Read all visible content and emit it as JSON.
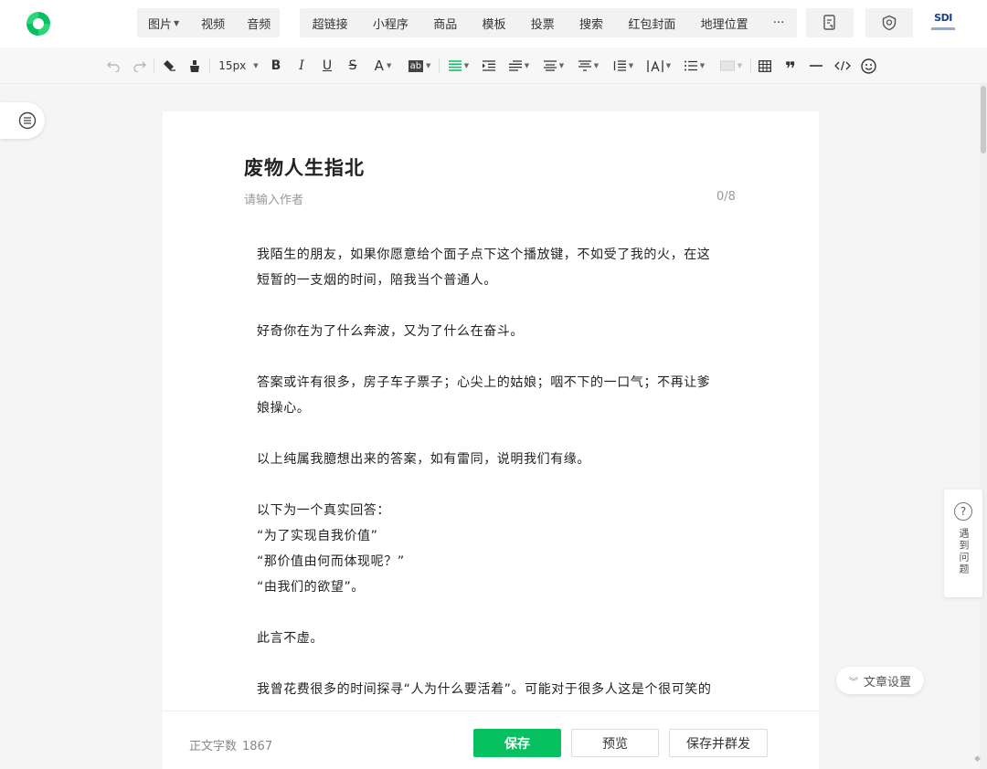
{
  "topbar": {
    "media_group": [
      {
        "label": "图片",
        "has_caret": true
      },
      {
        "label": "视频"
      },
      {
        "label": "音频"
      }
    ],
    "insert_group": [
      {
        "label": "超链接"
      },
      {
        "label": "小程序"
      },
      {
        "label": "商品"
      },
      {
        "label": "模板"
      },
      {
        "label": "投票"
      },
      {
        "label": "搜索"
      },
      {
        "label": "红包封面"
      },
      {
        "label": "地理位置"
      },
      {
        "label": "···"
      }
    ],
    "brand": {
      "logo_text": "SDI",
      "accent": "#07c160"
    }
  },
  "format_toolbar": {
    "font_size": "15px",
    "icons": [
      "undo-icon",
      "redo-icon",
      "format-painter-icon",
      "clear-format-icon",
      "bold-icon",
      "italic-icon",
      "underline-icon",
      "strikethrough-icon",
      "font-color-icon",
      "background-color-icon",
      "align-icon",
      "indent-icon",
      "first-line-indent-icon",
      "paragraph-spacing-before-icon",
      "paragraph-spacing-after-icon",
      "line-height-icon",
      "letter-spacing-icon",
      "list-icon",
      "border-icon",
      "table-icon",
      "quote-icon",
      "divider-icon",
      "code-icon",
      "emoji-icon"
    ],
    "labels": {
      "bold": "B",
      "italic": "I",
      "underline": "U",
      "strike": "S",
      "font_color": "A",
      "bg_color": "ab"
    }
  },
  "editor": {
    "title": "废物人生指北",
    "author_placeholder": "请输入作者",
    "author_count": "0/8",
    "paragraphs": [
      {
        "text": "我陌生的朋友，如果你愿意给个面子点下这个播放键，不如受了我的火，在这"
      },
      {
        "text": "短暂的一支烟的时间，陪我当个普通人。"
      },
      {
        "text": ""
      },
      {
        "text": "好奇你在为了什么奔波，又为了什么在奋斗。"
      },
      {
        "text": ""
      },
      {
        "text": "答案或许有很多，房子车子票子；心尖上的姑娘；咽不下的一口气；不再让爹"
      },
      {
        "text": "娘操心。"
      },
      {
        "text": ""
      },
      {
        "text": "以上纯属我臆想出来的答案，如有雷同，说明我们有缘。"
      },
      {
        "text": ""
      },
      {
        "text": "以下为一个真实回答："
      },
      {
        "text": "“为了实现自我价值”"
      },
      {
        "text": "“那价值由何而体现呢？”"
      },
      {
        "text": "“由我们的欲望”。"
      },
      {
        "text": ""
      },
      {
        "text": "此言不虚。"
      },
      {
        "text": ""
      },
      {
        "text": "我曾花费很多的时间探寻“人为什么要活着”。可能对于很多人这是个很可笑的"
      }
    ]
  },
  "side": {
    "help_text": "遇到问题",
    "help_symbol": "?",
    "article_settings": "文章设置"
  },
  "bottombar": {
    "word_count_label": "正文字数",
    "word_count_value": "1867",
    "save_label": "保存",
    "preview_label": "预览",
    "save_and_send_label": "保存并群发"
  }
}
